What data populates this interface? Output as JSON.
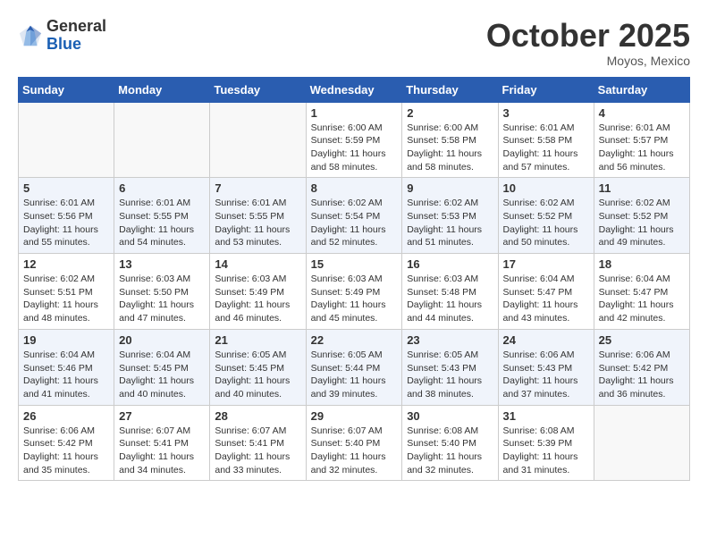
{
  "header": {
    "logo_general": "General",
    "logo_blue": "Blue",
    "month": "October 2025",
    "location": "Moyos, Mexico"
  },
  "days_of_week": [
    "Sunday",
    "Monday",
    "Tuesday",
    "Wednesday",
    "Thursday",
    "Friday",
    "Saturday"
  ],
  "weeks": [
    [
      {
        "day": "",
        "info": ""
      },
      {
        "day": "",
        "info": ""
      },
      {
        "day": "",
        "info": ""
      },
      {
        "day": "1",
        "info": "Sunrise: 6:00 AM\nSunset: 5:59 PM\nDaylight: 11 hours and 58 minutes."
      },
      {
        "day": "2",
        "info": "Sunrise: 6:00 AM\nSunset: 5:58 PM\nDaylight: 11 hours and 58 minutes."
      },
      {
        "day": "3",
        "info": "Sunrise: 6:01 AM\nSunset: 5:58 PM\nDaylight: 11 hours and 57 minutes."
      },
      {
        "day": "4",
        "info": "Sunrise: 6:01 AM\nSunset: 5:57 PM\nDaylight: 11 hours and 56 minutes."
      }
    ],
    [
      {
        "day": "5",
        "info": "Sunrise: 6:01 AM\nSunset: 5:56 PM\nDaylight: 11 hours and 55 minutes."
      },
      {
        "day": "6",
        "info": "Sunrise: 6:01 AM\nSunset: 5:55 PM\nDaylight: 11 hours and 54 minutes."
      },
      {
        "day": "7",
        "info": "Sunrise: 6:01 AM\nSunset: 5:55 PM\nDaylight: 11 hours and 53 minutes."
      },
      {
        "day": "8",
        "info": "Sunrise: 6:02 AM\nSunset: 5:54 PM\nDaylight: 11 hours and 52 minutes."
      },
      {
        "day": "9",
        "info": "Sunrise: 6:02 AM\nSunset: 5:53 PM\nDaylight: 11 hours and 51 minutes."
      },
      {
        "day": "10",
        "info": "Sunrise: 6:02 AM\nSunset: 5:52 PM\nDaylight: 11 hours and 50 minutes."
      },
      {
        "day": "11",
        "info": "Sunrise: 6:02 AM\nSunset: 5:52 PM\nDaylight: 11 hours and 49 minutes."
      }
    ],
    [
      {
        "day": "12",
        "info": "Sunrise: 6:02 AM\nSunset: 5:51 PM\nDaylight: 11 hours and 48 minutes."
      },
      {
        "day": "13",
        "info": "Sunrise: 6:03 AM\nSunset: 5:50 PM\nDaylight: 11 hours and 47 minutes."
      },
      {
        "day": "14",
        "info": "Sunrise: 6:03 AM\nSunset: 5:49 PM\nDaylight: 11 hours and 46 minutes."
      },
      {
        "day": "15",
        "info": "Sunrise: 6:03 AM\nSunset: 5:49 PM\nDaylight: 11 hours and 45 minutes."
      },
      {
        "day": "16",
        "info": "Sunrise: 6:03 AM\nSunset: 5:48 PM\nDaylight: 11 hours and 44 minutes."
      },
      {
        "day": "17",
        "info": "Sunrise: 6:04 AM\nSunset: 5:47 PM\nDaylight: 11 hours and 43 minutes."
      },
      {
        "day": "18",
        "info": "Sunrise: 6:04 AM\nSunset: 5:47 PM\nDaylight: 11 hours and 42 minutes."
      }
    ],
    [
      {
        "day": "19",
        "info": "Sunrise: 6:04 AM\nSunset: 5:46 PM\nDaylight: 11 hours and 41 minutes."
      },
      {
        "day": "20",
        "info": "Sunrise: 6:04 AM\nSunset: 5:45 PM\nDaylight: 11 hours and 40 minutes."
      },
      {
        "day": "21",
        "info": "Sunrise: 6:05 AM\nSunset: 5:45 PM\nDaylight: 11 hours and 40 minutes."
      },
      {
        "day": "22",
        "info": "Sunrise: 6:05 AM\nSunset: 5:44 PM\nDaylight: 11 hours and 39 minutes."
      },
      {
        "day": "23",
        "info": "Sunrise: 6:05 AM\nSunset: 5:43 PM\nDaylight: 11 hours and 38 minutes."
      },
      {
        "day": "24",
        "info": "Sunrise: 6:06 AM\nSunset: 5:43 PM\nDaylight: 11 hours and 37 minutes."
      },
      {
        "day": "25",
        "info": "Sunrise: 6:06 AM\nSunset: 5:42 PM\nDaylight: 11 hours and 36 minutes."
      }
    ],
    [
      {
        "day": "26",
        "info": "Sunrise: 6:06 AM\nSunset: 5:42 PM\nDaylight: 11 hours and 35 minutes."
      },
      {
        "day": "27",
        "info": "Sunrise: 6:07 AM\nSunset: 5:41 PM\nDaylight: 11 hours and 34 minutes."
      },
      {
        "day": "28",
        "info": "Sunrise: 6:07 AM\nSunset: 5:41 PM\nDaylight: 11 hours and 33 minutes."
      },
      {
        "day": "29",
        "info": "Sunrise: 6:07 AM\nSunset: 5:40 PM\nDaylight: 11 hours and 32 minutes."
      },
      {
        "day": "30",
        "info": "Sunrise: 6:08 AM\nSunset: 5:40 PM\nDaylight: 11 hours and 32 minutes."
      },
      {
        "day": "31",
        "info": "Sunrise: 6:08 AM\nSunset: 5:39 PM\nDaylight: 11 hours and 31 minutes."
      },
      {
        "day": "",
        "info": ""
      }
    ]
  ]
}
